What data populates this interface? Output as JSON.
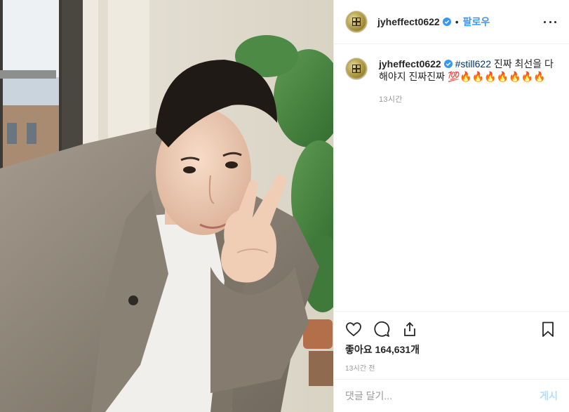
{
  "post": {
    "username": "jyheffect0622",
    "follow_label": "팔로우",
    "separator": "•"
  },
  "caption": {
    "username": "jyheffect0622",
    "hashtag": "#still622",
    "text": " 진짜 최선을 다해야지 진짜진짜 💯🔥🔥🔥🔥🔥🔥🔥",
    "time": "13시간"
  },
  "stats": {
    "likes": "좋아요 164,631개",
    "post_time": "13시간 전"
  },
  "comment_box": {
    "placeholder": "댓글 달기...",
    "post_label": "게시"
  },
  "colors": {
    "accent": "#3897f0",
    "hashtag": "#003569",
    "muted": "#999999",
    "post_disabled": "#b2dffc"
  },
  "icons": [
    "verified-badge-icon",
    "more-options-icon",
    "heart-icon",
    "comment-icon",
    "share-icon",
    "bookmark-icon"
  ]
}
